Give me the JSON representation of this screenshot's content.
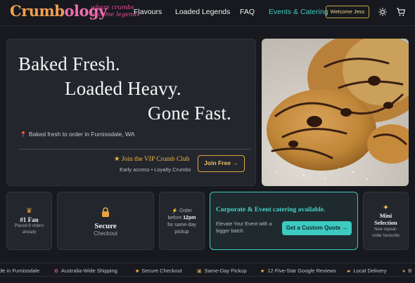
{
  "brand": {
    "name_a": "Crumb",
    "name_b": "ology",
    "tagline_line1": "where crumbs",
    "tagline_line2": "become legends"
  },
  "nav": {
    "links": [
      "Flavours",
      "Loaded Legends",
      "FAQ",
      "Events & Catering"
    ],
    "welcome": "Welcome Jess",
    "icons": {
      "theme": "sun-icon",
      "cart": "cart-icon"
    },
    "accent": "#3ec9c1"
  },
  "hero": {
    "line1": "Baked Fresh.",
    "line2": "Loaded Heavy.",
    "line3": "Gone Fast.",
    "location": "Baked fresh to order in Furnissdale, WA",
    "vip_title": "Join the VIP Crumb Club",
    "vip_sub": "Early access • Loyalty Crumbs",
    "join_label": "Join Free →"
  },
  "cards": {
    "fan": {
      "title": "#1 Fan",
      "sub1": "Placed 8 orders",
      "sub2": "already",
      "icon": "crown-icon"
    },
    "secure": {
      "title": "Secure",
      "sub": "Checkout",
      "icon": "lock-icon"
    },
    "order": {
      "line1": "Order",
      "line2a": "before ",
      "line2b": "12pm",
      "line3": "for same-day",
      "line4": "pickup",
      "icon": "lightning-icon"
    },
    "catering": {
      "title": "Corporate & Event catering available.",
      "sub": "Elevate Your Event with a bigger batch.",
      "button": "Get a Custom Quote →"
    },
    "mini": {
      "title1": "Mini",
      "title2": "Selection",
      "sub1": "New repeat-",
      "sub2": "order favourite",
      "icon": "sparkle-icon"
    }
  },
  "ticker": [
    {
      "icon": "",
      "text": "de in Furnissdale"
    },
    {
      "icon": "flower-icon",
      "text": "Australia-Wide Shipping"
    },
    {
      "icon": "lock-icon",
      "text": "Secure Checkout"
    },
    {
      "icon": "box-icon",
      "text": "Same-Day Pickup"
    },
    {
      "icon": "star-icon",
      "text": "12 Five-Star Google Reviews"
    },
    {
      "icon": "truck-icon",
      "text": "Local Delivery"
    },
    {
      "icon": "cookie-icon",
      "text": "B"
    }
  ]
}
